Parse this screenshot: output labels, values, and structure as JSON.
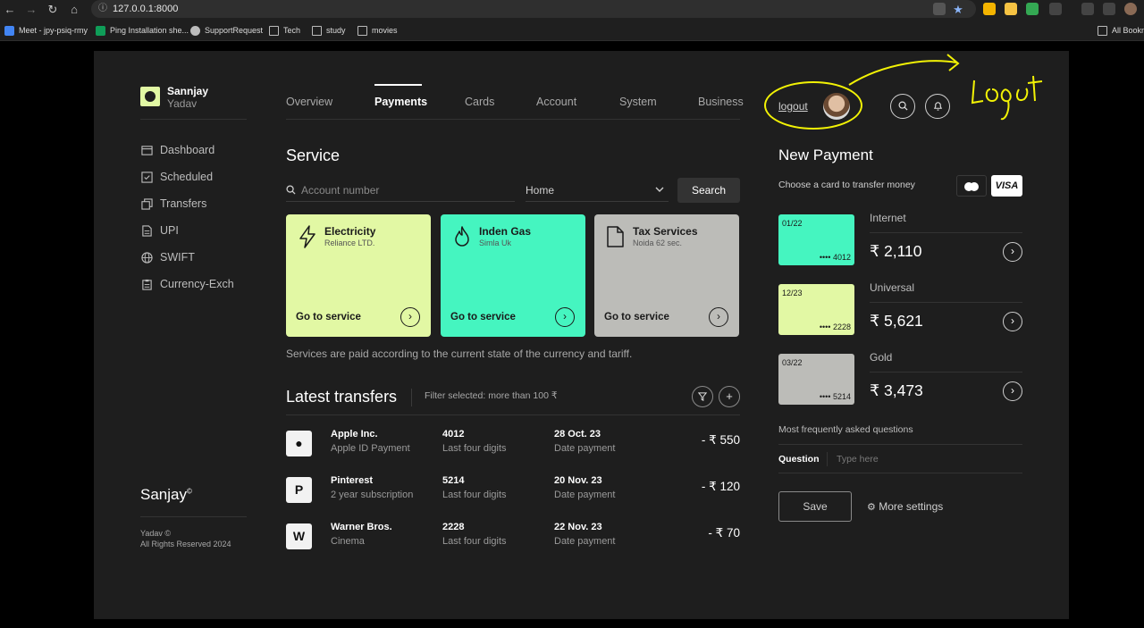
{
  "browser": {
    "url": "127.0.0.1:8000",
    "bookmarks": [
      "Meet - jpy-psiq-rmy",
      "Ping Installation she...",
      "SupportRequest",
      "Tech",
      "study",
      "movies"
    ],
    "all_bookmarks": "All Bookm"
  },
  "brand": {
    "first": "Sannjay",
    "last": "Yadav"
  },
  "tabs": [
    "Overview",
    "Payments",
    "Cards",
    "Account",
    "System",
    "Business"
  ],
  "sidebar": {
    "items": [
      {
        "label": "Dashboard",
        "icon": "dashboard-icon"
      },
      {
        "label": "Scheduled",
        "icon": "check-square-icon"
      },
      {
        "label": "Transfers",
        "icon": "transfers-icon"
      },
      {
        "label": "UPI",
        "icon": "document-icon"
      },
      {
        "label": "SWIFT",
        "icon": "globe-icon"
      },
      {
        "label": "Currency-Exch",
        "icon": "clipboard-icon"
      }
    ]
  },
  "footer": {
    "brand": "Sanjay",
    "brand_mark": "©",
    "line1": "Yadav ©",
    "line2": "All Rights Reserved 2024"
  },
  "service": {
    "title": "Service",
    "search_placeholder": "Account number",
    "select_value": "Home",
    "search_button": "Search",
    "cards": [
      {
        "title": "Electricity",
        "subtitle": "Reliance LTD.",
        "action": "Go to service",
        "color": "#e2f8a4",
        "icon": "bolt-icon"
      },
      {
        "title": "Inden Gas",
        "subtitle": "Simla Uk",
        "action": "Go to service",
        "color": "#45f5c0",
        "icon": "flame-icon"
      },
      {
        "title": "Tax Services",
        "subtitle": "Noida 62 sec.",
        "action": "Go to service",
        "color": "#bcbcb8",
        "icon": "file-icon"
      }
    ],
    "note": "Services are paid according to the current state of the currency and tariff."
  },
  "transfers": {
    "title": "Latest transfers",
    "filter_note": "Filter selected: more than 100 ₹",
    "rows": [
      {
        "name": "Apple Inc.",
        "desc": "Apple ID Payment",
        "digits": "4012",
        "digits_label": "Last four digits",
        "date": "28 Oct. 23",
        "date_label": "Date payment",
        "amount": "- ₹ 550",
        "icon": "apple-icon"
      },
      {
        "name": "Pinterest",
        "desc": "2 year subscription",
        "digits": "5214",
        "digits_label": "Last four digits",
        "date": "20 Nov. 23",
        "date_label": "Date payment",
        "amount": "- ₹ 120",
        "icon": "pinterest-icon"
      },
      {
        "name": "Warner Bros.",
        "desc": "Cinema",
        "digits": "2228",
        "digits_label": "Last four digits",
        "date": "22 Nov. 23",
        "date_label": "Date payment",
        "amount": "- ₹ 70",
        "icon": "warner-icon"
      }
    ]
  },
  "header_right": {
    "logout": "logout"
  },
  "new_payment": {
    "title": "New Payment",
    "choose_text": "Choose a card to transfer money",
    "visa": "VISA",
    "cards": [
      {
        "date": "01/22",
        "number": "•••• 4012",
        "name": "Internet",
        "amount": "₹ 2,110",
        "color": "#45f5c0"
      },
      {
        "date": "12/23",
        "number": "•••• 2228",
        "name": "Universal",
        "amount": "₹ 5,621",
        "color": "#e2f8a4"
      },
      {
        "date": "03/22",
        "number": "•••• 5214",
        "name": "Gold",
        "amount": "₹ 3,473",
        "color": "#bcbcb8"
      }
    ],
    "faq": "Most frequently asked questions",
    "question_label": "Question",
    "question_placeholder": "Type here",
    "save": "Save",
    "more_settings": "More settings"
  }
}
